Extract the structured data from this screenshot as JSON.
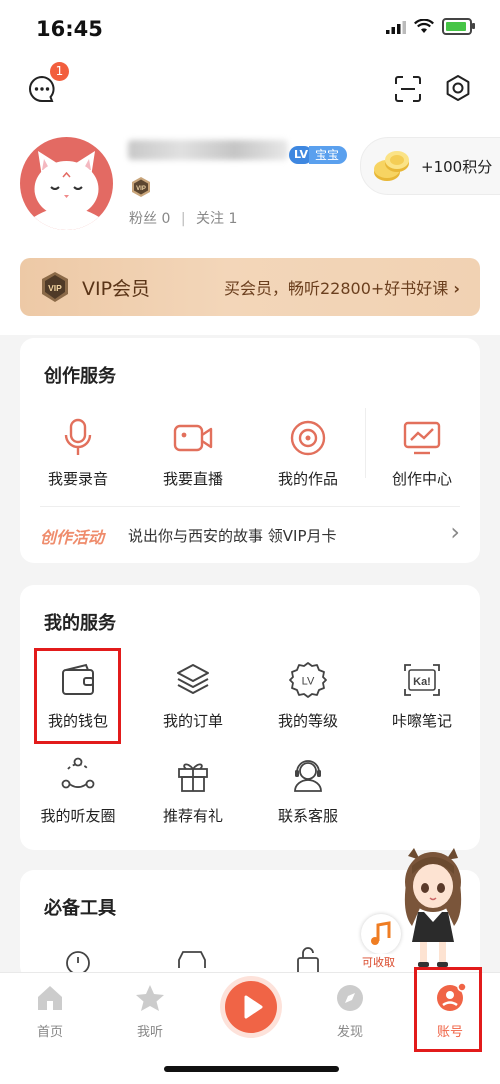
{
  "status_bar": {
    "time": "16:45"
  },
  "header": {
    "message_badge_count": "1"
  },
  "profile": {
    "vip_level_chip": "LV",
    "vip_level_text": "宝宝",
    "fans_label": "粉丝",
    "fans_count": "0",
    "following_label": "关注",
    "following_count": "1",
    "points_text": "+100积分",
    "vip_badge_text": "VIP"
  },
  "vip_banner": {
    "icon_text": "VIP",
    "title": "VIP会员",
    "promo": "买会员，畅听22800+好书好课",
    "arrow": "›"
  },
  "creation": {
    "title": "创作服务",
    "items": [
      {
        "label": "我要录音",
        "icon": "microphone-icon"
      },
      {
        "label": "我要直播",
        "icon": "video-camera-icon"
      },
      {
        "label": "我的作品",
        "icon": "disc-icon"
      },
      {
        "label": "创作中心",
        "icon": "chart-screen-icon"
      }
    ],
    "activity_tag": "创作活动",
    "activity_text": "说出你与西安的故事 领VIP月卡",
    "activity_arrow": "›"
  },
  "my_services": {
    "title": "我的服务",
    "items": [
      {
        "label": "我的钱包",
        "icon": "wallet-icon"
      },
      {
        "label": "我的订单",
        "icon": "layers-icon"
      },
      {
        "label": "我的等级",
        "icon": "level-icon",
        "icon_text": "LV"
      },
      {
        "label": "咔嚓笔记",
        "icon": "note-icon",
        "icon_text": "Ka!"
      },
      {
        "label": "我的听友圈",
        "icon": "circle-icon"
      },
      {
        "label": "推荐有礼",
        "icon": "gift-icon"
      },
      {
        "label": "联系客服",
        "icon": "headset-icon"
      }
    ]
  },
  "tools": {
    "title": "必备工具",
    "float_label": "可收取"
  },
  "tabbar": {
    "items": [
      {
        "label": "首页"
      },
      {
        "label": "我听"
      },
      {
        "label": "发现"
      },
      {
        "label": "账号"
      }
    ]
  },
  "colors": {
    "accent": "#f06446",
    "highlight": "#e21b1b"
  }
}
